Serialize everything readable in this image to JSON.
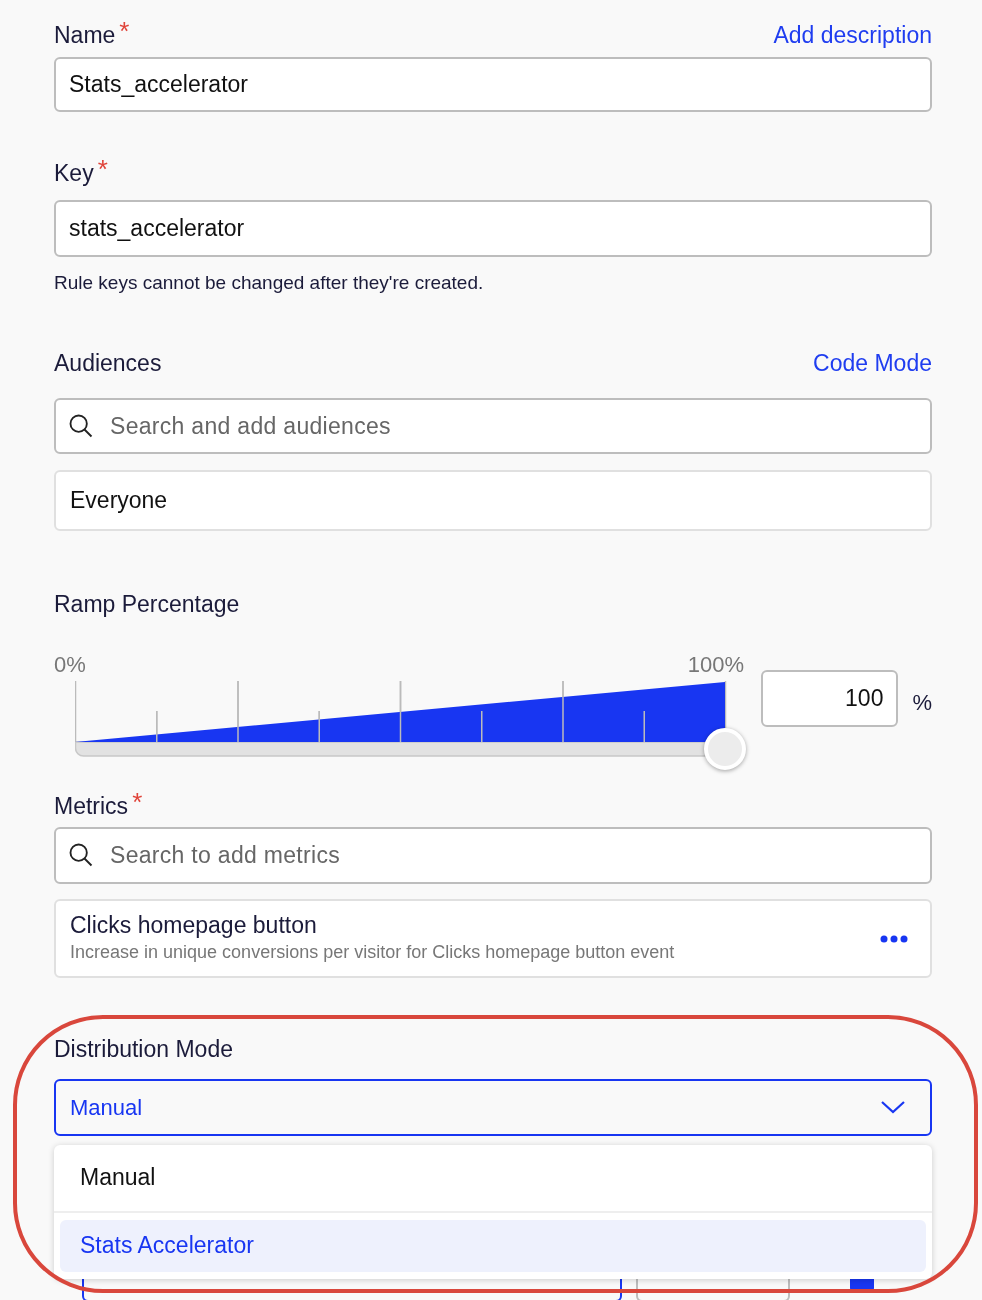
{
  "name": {
    "label": "Name",
    "required_mark": "*",
    "link": "Add description",
    "value": "Stats_accelerator"
  },
  "key": {
    "label": "Key",
    "required_mark": "*",
    "value": "stats_accelerator",
    "help": "Rule keys cannot be changed after they're created."
  },
  "audiences": {
    "label": "Audiences",
    "link": "Code Mode",
    "placeholder": "Search and add audiences",
    "items": [
      {
        "label": "Everyone"
      }
    ]
  },
  "ramp": {
    "label": "Ramp Percentage",
    "min_label": "0%",
    "max_label": "100%",
    "level": 1,
    "value": "100",
    "unit": "%"
  },
  "metrics": {
    "label": "Metrics",
    "required_mark": "*",
    "placeholder": "Search to add metrics",
    "items": [
      {
        "title": "Clicks homepage button",
        "description": "Increase in unique conversions per visitor for Clicks homepage button event"
      }
    ]
  },
  "distribution": {
    "label": "Distribution Mode",
    "value": "Manual",
    "expanded": true,
    "checkbox": {
      "checked": true
    },
    "options": [
      {
        "label": "Manual",
        "selected": true,
        "highlighted": false
      },
      {
        "label": "Stats Accelerator",
        "selected": false,
        "highlighted": true
      }
    ]
  }
}
